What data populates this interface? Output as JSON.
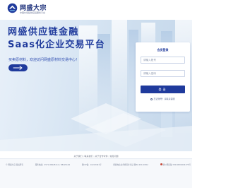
{
  "brand": {
    "name": "网盛大宗",
    "subtitle": "中国价值链供应链服务平台"
  },
  "hero": {
    "headline_1": "网盛供应链金融",
    "headline_2": "Saas化企业交易平台",
    "tagline": "买卖原材料，欢迎访问网盛原材料交易中心！",
    "arrow_button_icon": "arrow-right"
  },
  "login": {
    "title": "会员登录",
    "username_placeholder": "请输入账号",
    "password_placeholder": "请输入密码",
    "submit_label": "登录",
    "forgot_label": "忘记账号？请联系客服"
  },
  "footer": {
    "links": [
      "关于我们",
      "联系我们",
      "关于合作伙伴",
      "常见问题"
    ],
    "company": "© 网盛大宗 版权所有",
    "phone": "服务热线：0571-88228111 / 88229192",
    "icp": "浙ICP备：10213491号",
    "license": "增值电信业务经营许可证 浙B2-20110302",
    "police": "浙公网安备 33010802004370号"
  },
  "colors": {
    "brand_blue": "#1f3a9c",
    "hero_bg": "#d4e3f1",
    "panel_bg": "#ffffff"
  }
}
